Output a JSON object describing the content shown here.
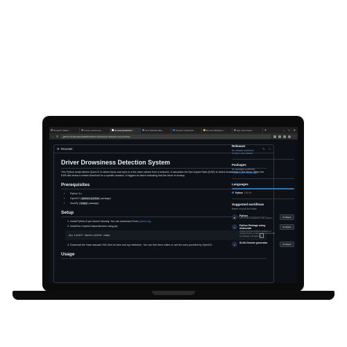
{
  "browser": {
    "tabs": [
      {
        "label": "Dumped | Platfo..."
      },
      {
        "label": "Cómo a secciones..."
      },
      {
        "label": "RenukaJasaliGFG/...",
        "active": true
      },
      {
        "label": "How Website Was..."
      },
      {
        "label": "Kanwar | Facebook..."
      },
      {
        "label": "Remove Backgrou..."
      },
      {
        "label": "app: deer.drowsi..."
      }
    ],
    "new_tab": "+",
    "url": "github.com/RenukaJasaliGFG/Driver-Drowsiness-Detection-using-Python"
  },
  "readme": {
    "tab_label": "README",
    "title": "Driver Drowsiness Detection System",
    "intro": "This Python script utilizes OpenCV to detect faces and eyes in a live video stream from a webcam. It calculates the Eye Aspect Ratio (EAR) to detect drowsiness in the driver. When the EAR falls below a certain threshold for a specific duration, it triggers an alarm indicating that the driver is drowsy.",
    "prereq_heading": "Prerequisites",
    "prereqs": [
      {
        "text": "Python 3.x"
      },
      {
        "before": "OpenCV (",
        "code": "opencv-python",
        "after": " package)"
      },
      {
        "before": "NumPy (",
        "code": "numpy",
        "after": " package)"
      }
    ],
    "setup_heading": "Setup",
    "step1_before": "Install Python if you haven't already. You can download it from ",
    "step1_link": "python.org",
    "step1_after": ".",
    "step2": "Install the required dependencies using pip:",
    "pip_command": "pip install opencv-python numpy",
    "step3": "Download the Haar cascade XML files for face and eye detection. You can find them online or use the ones provided by OpenCV.",
    "usage_heading": "Usage"
  },
  "sidebar": {
    "releases_title": "Releases",
    "releases_muted": "No releases published",
    "releases_link": "Create a new release",
    "packages_title": "Packages",
    "packages_muted": "No packages published",
    "packages_link": "Publish your first package",
    "languages_title": "Languages",
    "language_name": "Python",
    "language_pct": "100.0%",
    "language_color": "#3572A5",
    "workflows_title": "Suggested workflows",
    "workflows_sub": "Based on your tech stack",
    "workflows": [
      {
        "name": "Python",
        "desc": "Lint a Python application with pyflakes.",
        "button": "Configure",
        "icon": "python-icon"
      },
      {
        "name": "Python Package using Anaconda",
        "desc": "Create and test a Python package on multiple Python versions using Anaconda for package management.",
        "button": "Configure",
        "icon": "anaconda-icon"
      },
      {
        "name": "SLSA Generic generator",
        "desc": "",
        "button": "Configure",
        "icon": "slsa-icon"
      }
    ]
  }
}
